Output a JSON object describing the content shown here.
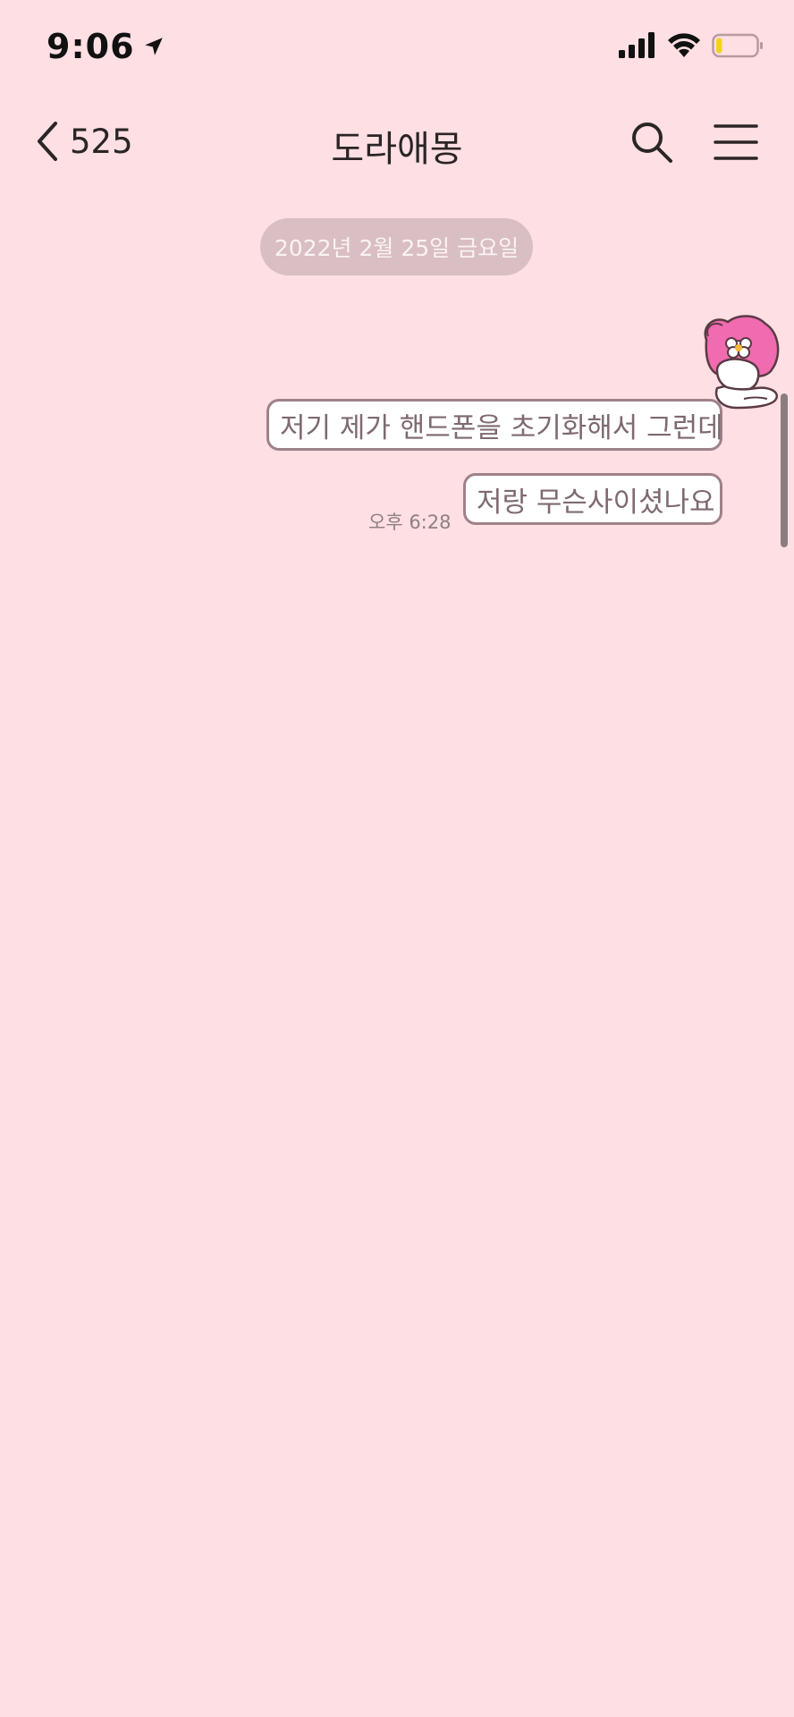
{
  "status_bar": {
    "time": "9:06",
    "icons": [
      "location-arrow-icon",
      "cellular-signal-icon",
      "wifi-icon",
      "battery-icon"
    ],
    "battery_level": 0.15,
    "battery_color": "#F2D31A"
  },
  "header": {
    "back_count": "525",
    "title": "도라애몽",
    "icons": [
      "chevron-left-icon",
      "search-icon",
      "hamburger-menu-icon"
    ]
  },
  "chat": {
    "date_divider": "2022년 2월 25일 금요일",
    "sticker": "pink-rabbit-character-sticker",
    "messages": [
      {
        "side": "sent",
        "text": "저기 제가 핸드폰을 초기화해서 그런데"
      },
      {
        "side": "sent",
        "text": "저랑 무슨사이셨나요",
        "time": "오후 6:28"
      }
    ]
  },
  "theme": {
    "background": "#FEDFE3",
    "date_pill": "#D9BEC3",
    "bubble_border": "#9E8289",
    "bubble_text": "#7E6A70"
  }
}
